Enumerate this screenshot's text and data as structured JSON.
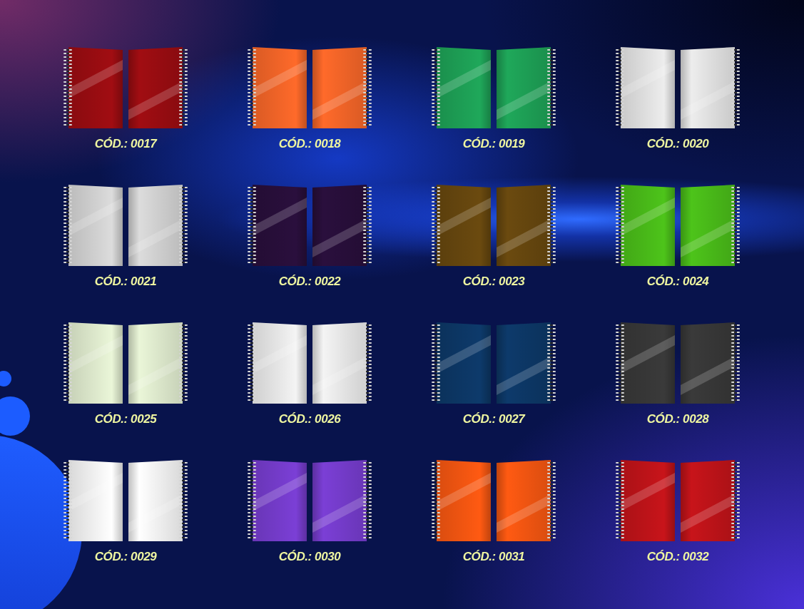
{
  "products": [
    {
      "code": "CÓD.: 0017",
      "color": "#a10d12"
    },
    {
      "code": "CÓD.: 0018",
      "color": "#ff6a2a"
    },
    {
      "code": "CÓD.: 0019",
      "color": "#1fa85a"
    },
    {
      "code": "CÓD.: 0020",
      "color": "#ededed"
    },
    {
      "code": "CÓD.: 0021",
      "color": "#dcdcdc"
    },
    {
      "code": "CÓD.: 0022",
      "color": "#2a0f3d"
    },
    {
      "code": "CÓD.: 0023",
      "color": "#6b4a0f"
    },
    {
      "code": "CÓD.: 0024",
      "color": "#4dc41a"
    },
    {
      "code": "CÓD.: 0025",
      "color": "#eaf6d8"
    },
    {
      "code": "CÓD.: 0026",
      "color": "#f4f4f4"
    },
    {
      "code": "CÓD.: 0027",
      "color": "#0d3a6b"
    },
    {
      "code": "CÓD.: 0028",
      "color": "#3a3a3a"
    },
    {
      "code": "CÓD.: 0029",
      "color": "#ffffff"
    },
    {
      "code": "CÓD.: 0030",
      "color": "#7b3fd6"
    },
    {
      "code": "CÓD.: 0031",
      "color": "#ff5a12"
    },
    {
      "code": "CÓD.: 0032",
      "color": "#c8141a"
    }
  ]
}
